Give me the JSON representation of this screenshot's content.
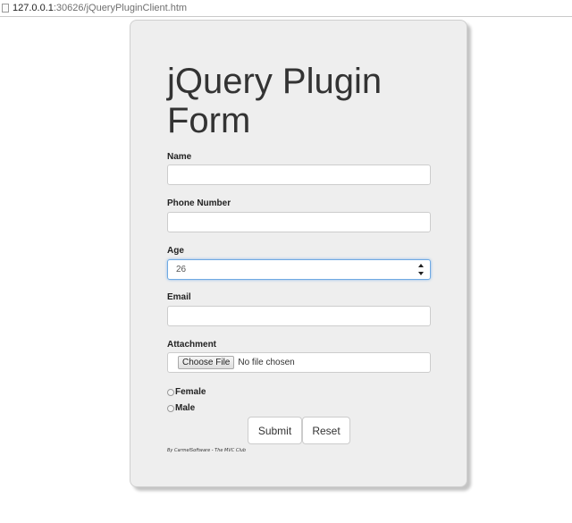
{
  "browser": {
    "url_host": "127.0.0.1",
    "url_rest": ":30626/jQueryPluginClient.htm"
  },
  "form": {
    "title": "jQuery Plugin Form",
    "fields": {
      "name": {
        "label": "Name",
        "value": ""
      },
      "phone": {
        "label": "Phone Number",
        "value": ""
      },
      "age": {
        "label": "Age",
        "value": "26"
      },
      "email": {
        "label": "Email",
        "value": ""
      },
      "attachment": {
        "label": "Attachment",
        "button_label": "Choose File",
        "status": "No file chosen"
      }
    },
    "gender_options": [
      "Female",
      "Male"
    ],
    "submit_label": "Submit",
    "reset_label": "Reset",
    "footer": "By CarmelSoftware - The MVC Club"
  }
}
